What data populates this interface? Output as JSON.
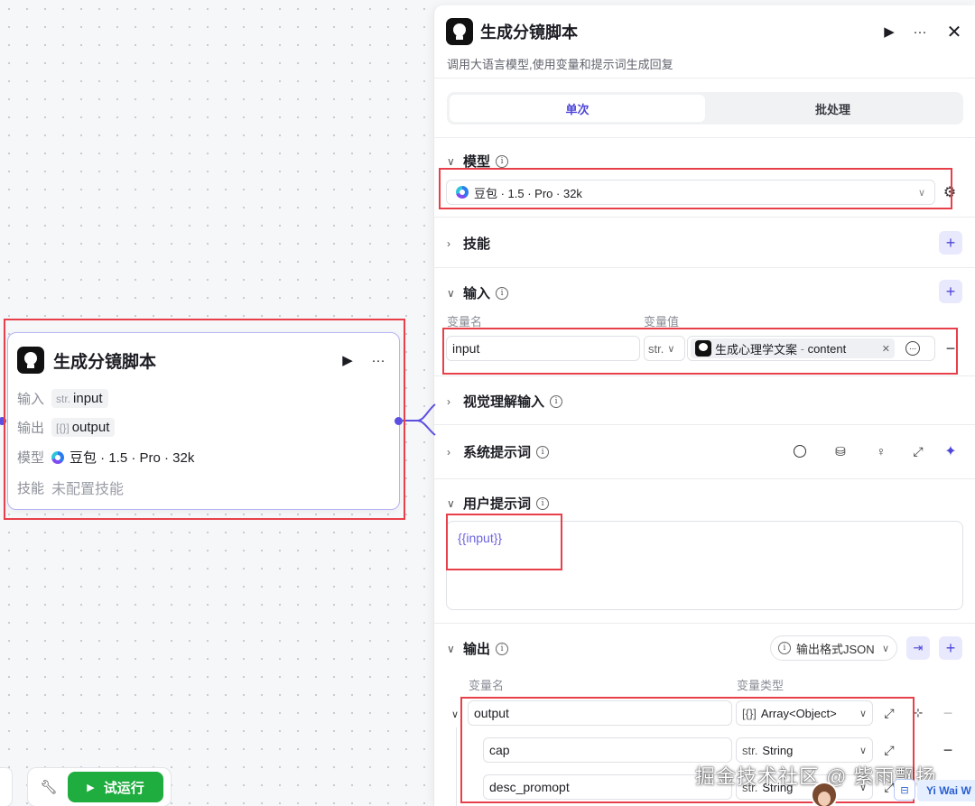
{
  "node": {
    "title": "生成分镜脚本",
    "input_label": "输入",
    "input_type": "str.",
    "input_name": "input",
    "output_label": "输出",
    "output_type": "[{}]",
    "output_name": "output",
    "model_label": "模型",
    "model_value": "豆包 · 1.5 · Pro · 32k",
    "skills_label": "技能",
    "skills_value": "未配置技能"
  },
  "bottom_bar": {
    "run_label": "试运行"
  },
  "panel": {
    "title": "生成分镜脚本",
    "description": "调用大语言模型,使用变量和提示词生成回复",
    "tabs": [
      {
        "label": "单次"
      },
      {
        "label": "批处理"
      }
    ],
    "model": {
      "section_label": "模型",
      "selected": "豆包 · 1.5 · Pro · 32k"
    },
    "skills": {
      "section_label": "技能"
    },
    "input": {
      "section_label": "输入",
      "col_name": "变量名",
      "col_value": "变量值",
      "var_name": "input",
      "var_type": "str.",
      "ref_node": "生成心理学文案",
      "ref_separator": " - ",
      "ref_field": "content"
    },
    "visual_input": {
      "section_label": "视觉理解输入"
    },
    "system_prompt": {
      "section_label": "系统提示词"
    },
    "user_prompt": {
      "section_label": "用户提示词",
      "text": "{{input}}"
    },
    "output": {
      "section_label": "输出",
      "format_label": "输出格式JSON",
      "col_name": "变量名",
      "col_type": "变量类型",
      "rows": [
        {
          "name": "output",
          "type_prefix": "[{}]",
          "type": "Array<Object>"
        },
        {
          "name": "cap",
          "type_prefix": "str.",
          "type": "String"
        },
        {
          "name": "desc_promopt",
          "type_prefix": "str.",
          "type": "String"
        }
      ]
    }
  },
  "watermark": "掘金技术社区 @ 紫雨飘扬",
  "user_tag": "Yi Wai W",
  "colors": {
    "accent": "#4e46d8",
    "run_green": "#1fad3f",
    "highlight_red": "#e8404a",
    "node_border": "#b6b4f3"
  }
}
